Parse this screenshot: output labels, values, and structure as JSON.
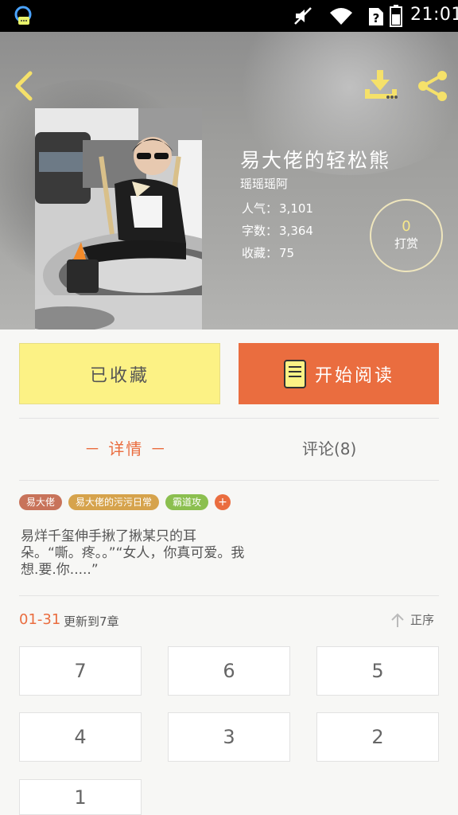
{
  "status_bar": {
    "time": "21:01"
  },
  "book": {
    "title": "易大佬的轻松熊",
    "author": "瑶瑶瑶阿",
    "popularity_label": "人气：",
    "popularity": "3,101",
    "word_count_label": "字数：",
    "word_count": "3,364",
    "favorites_label": "收藏：",
    "favorites": "75"
  },
  "tip": {
    "count": "0",
    "label": "打赏"
  },
  "actions": {
    "collected_label": "已收藏",
    "read_label": "开始阅读"
  },
  "tabs": {
    "detail": "－ 详情 －",
    "comments": "评论(8)"
  },
  "tags": [
    {
      "label": "易大佬",
      "color": "#c8735a"
    },
    {
      "label": "易大佬的污污日常",
      "color": "#d6a34c"
    },
    {
      "label": "霸道攻",
      "color": "#8bbf4f"
    },
    {
      "label": "+",
      "color": "#ea6d3f"
    }
  ],
  "description_lines": [
    "易烊千玺伸手揪了揪某只的耳",
    "朵。“嘶。疼。。”“女人，你真可爱。我",
    "想.要.你.....”"
  ],
  "updates": {
    "date": "01-31",
    "text": "更新到7章",
    "sort_label": "正序"
  },
  "chapters": [
    "7",
    "6",
    "5",
    "4",
    "3",
    "2",
    "1"
  ],
  "colors": {
    "accent": "#ea6d3f",
    "collected_bg": "#fcf285",
    "icon_yellow": "#f5e16a"
  },
  "icons": [
    "back-arrow-icon",
    "download-icon",
    "share-icon",
    "book-icon",
    "sort-up-arrow-icon"
  ]
}
